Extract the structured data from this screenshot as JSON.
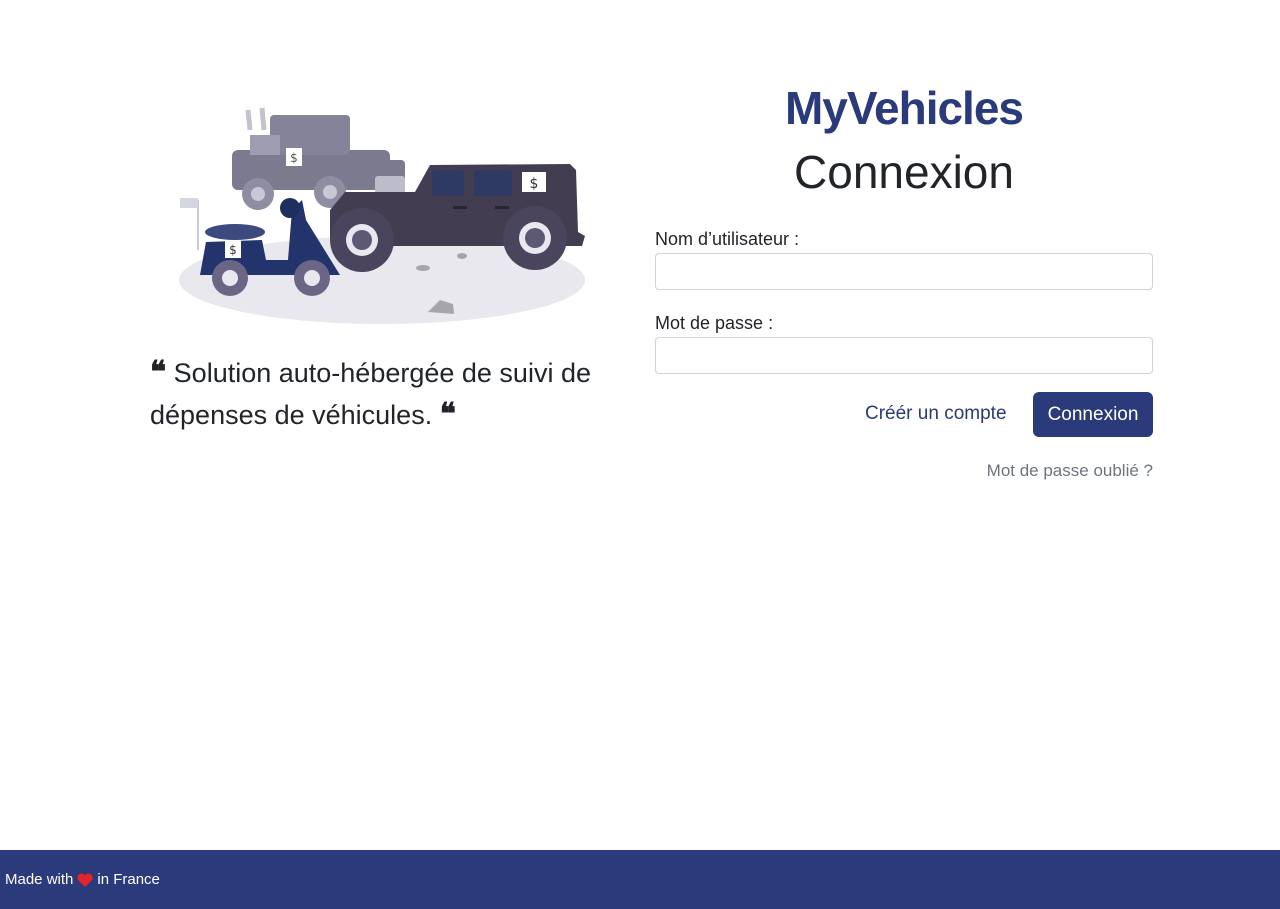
{
  "brand": {
    "name": "MyVehicles"
  },
  "login": {
    "title": "Connexion",
    "username_label": "Nom d’utilisateur :",
    "username_value": "",
    "password_label": "Mot de passe :",
    "password_value": "",
    "create_account_label": "Créér un compte",
    "submit_label": "Connexion",
    "forgot_password_label": "Mot de passe oublié ?"
  },
  "hero": {
    "illustration": "vehicles-illustration",
    "quote_open": "❝",
    "quote_text": "Solution auto-hébergée de suivi de dépenses de véhicules.",
    "quote_close": "❝"
  },
  "footer": {
    "prefix": "Made with",
    "icon": "heart-icon",
    "suffix": "in France"
  },
  "colors": {
    "brand": "#2a3a7a",
    "heart": "#e0262b",
    "muted": "#6c757d"
  }
}
